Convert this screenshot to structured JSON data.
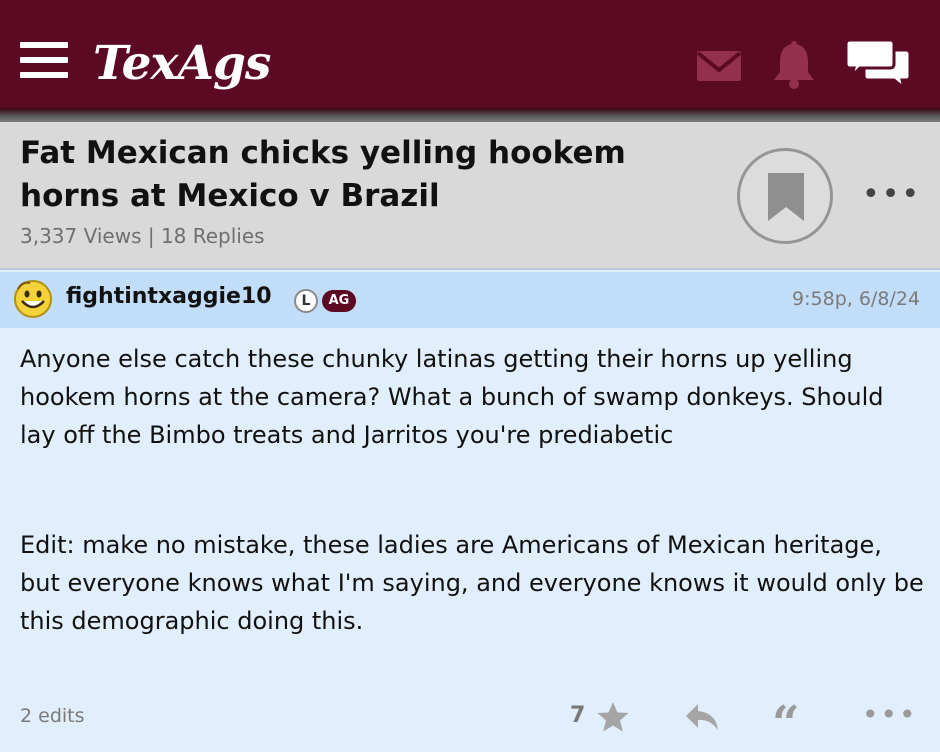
{
  "app": {
    "logo_text": "TexAgs",
    "brand_color": "#5c0a24",
    "icons": [
      "menu-icon",
      "mail-icon",
      "bell-icon",
      "chat-icon"
    ]
  },
  "thread": {
    "title": "Fat Mexican chicks yelling hookem horns at Mexico v Brazil",
    "stats": "3,337 Views | 18 Replies",
    "more_label": "•••"
  },
  "post": {
    "username": "fightintxaggie10",
    "badge_l": "L",
    "badge_ag": "AG",
    "timestamp": "9:58p, 6/8/24",
    "body_paragraph_1": "Anyone else catch these chunky latinas getting their horns up yelling hookem horns at the camera? What a bunch of swamp donkeys. Should lay off the Bimbo treats and Jarritos you're prediabetic",
    "body_paragraph_2": "Edit: make no mistake, these ladies are Americans of Mexican heritage, but everyone knows what I'm saying, and everyone knows it would only be this demographic doing this.",
    "edits": "2 edits",
    "star_count": "7",
    "quote_glyph": "“",
    "more_label": "•••"
  }
}
